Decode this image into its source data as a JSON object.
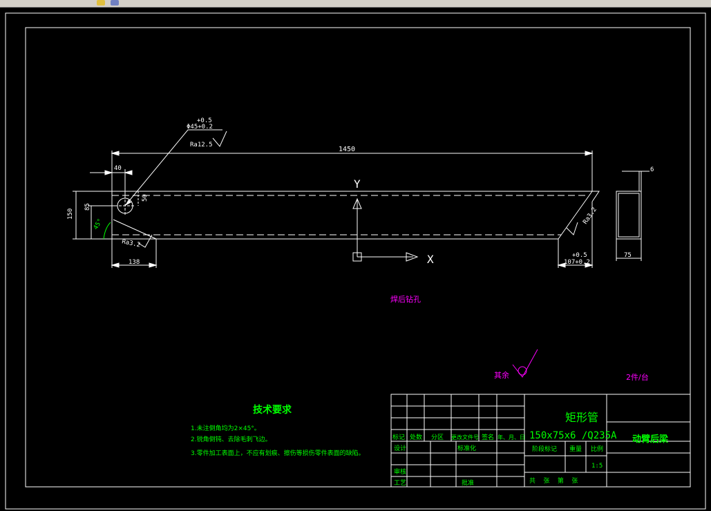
{
  "toolbar": {
    "icons": [
      "lock-icon",
      "cube-icon"
    ]
  },
  "drawing": {
    "dims": {
      "length": "1450",
      "left_offset": "40",
      "height": "150",
      "hole_center": "85",
      "hole_offset": "50",
      "bottom_left": "138",
      "hole_tol_upper": "+0.5",
      "hole_tol_lower": "Φ45+0.2",
      "roughness_hole": "Ra12.5",
      "roughness_left": "Ra3.2",
      "roughness_right": "Ra3.2",
      "angle": "45°",
      "right_tol_upper": "+0.5",
      "right_dim": "107+0.2",
      "section_width": "75",
      "section_wall": "6"
    },
    "axis": {
      "y": "Y",
      "x": "X"
    },
    "note_weld": "焊后钻孔",
    "note_rest": "其余",
    "note_qty": "2件/台"
  },
  "tech": {
    "title": "技术要求",
    "items": [
      "1.未注倒角均为2×45°。",
      "2.锐角倒钝、去除毛刺飞边。",
      "3.零件加工表面上，不应有划痕、擦伤等损伤零件表面的缺陷。"
    ]
  },
  "title_block": {
    "material_name": "矩形管",
    "material_spec": "150x75x6  /Q235A",
    "part_name": "动臂后梁",
    "row_labels": [
      "标记",
      "处数",
      "分区",
      "更改文件号",
      "签名",
      "年、月、日"
    ],
    "design": "设计",
    "standard": "标准化",
    "review": "审核",
    "process": "工艺",
    "approve": "批准",
    "stage": "阶段标记",
    "weight": "重量",
    "scale_label": "比例",
    "scale": "1:5",
    "sheets": "共    张    第    张"
  },
  "colors": {
    "white": "#ffffff",
    "green": "#00ff00",
    "magenta": "#ff00ff",
    "accent": "#00ff00"
  }
}
